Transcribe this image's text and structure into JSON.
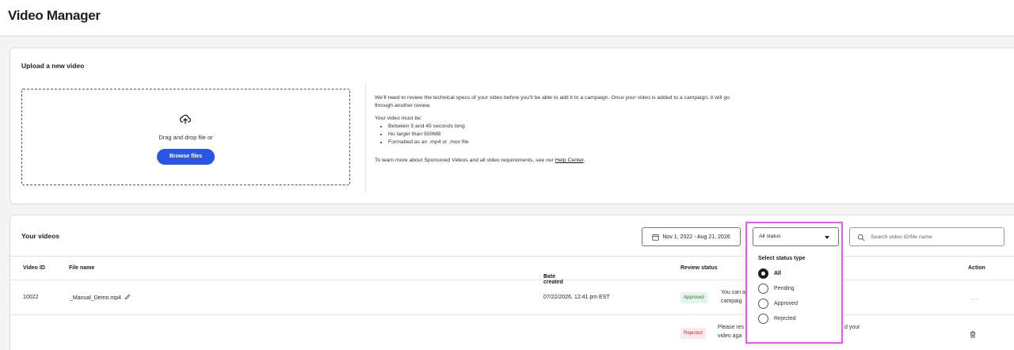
{
  "page": {
    "title": "Video Manager"
  },
  "upload": {
    "title": "Upload a new video",
    "drag_text": "Drag and drop file or",
    "browse_label": "Browse files",
    "info_intro": "We’ll need to review the technical specs of your video before you’ll be able to add it to a campaign. Once your video is added to a campaign, it will go through another review.",
    "requirements_heading": "Your video must be:",
    "requirements": [
      "Between 5 and 45 seconds long",
      "No larger than 500MB",
      "Formatted as an .mp4 or .mov file"
    ],
    "learn_prefix": "To learn more about Sponsored Videos and all video requirements, see our ",
    "help_link": "Help Center",
    "learn_suffix": "."
  },
  "videos": {
    "title": "Your videos",
    "date_range": "Nov 1, 2022 - Aug 21, 2026",
    "status_value": "All status",
    "search_placeholder": "Search video ID/file name",
    "columns": {
      "video_id": "Video ID",
      "file_name": "File name",
      "date_created": "Date created",
      "review_status": "Review status",
      "action": "Action"
    },
    "rows": [
      {
        "video_id": "10022",
        "file_name": "_Manual_Demo.mp4",
        "date_created": "07/22/2026, 12:41 pm EST",
        "status": "Approved",
        "review_line1": "You can a",
        "review_line2": "campaig",
        "action": "···"
      },
      {
        "video_id": "",
        "file_name": "",
        "date_created": "",
        "status": "Rejected",
        "review_line1": "Please res",
        "review_line1b": "d your",
        "review_line2": "video aga"
      }
    ]
  },
  "status_dropdown": {
    "title": "Select status type",
    "options": [
      "All",
      "Pending",
      "Approved",
      "Rejected"
    ],
    "selected": "All"
  },
  "colors": {
    "accent": "#2b55e6",
    "highlight": "#ea58f0",
    "approved_bg": "#e6f4ea",
    "rejected_bg": "#fde9e9"
  }
}
